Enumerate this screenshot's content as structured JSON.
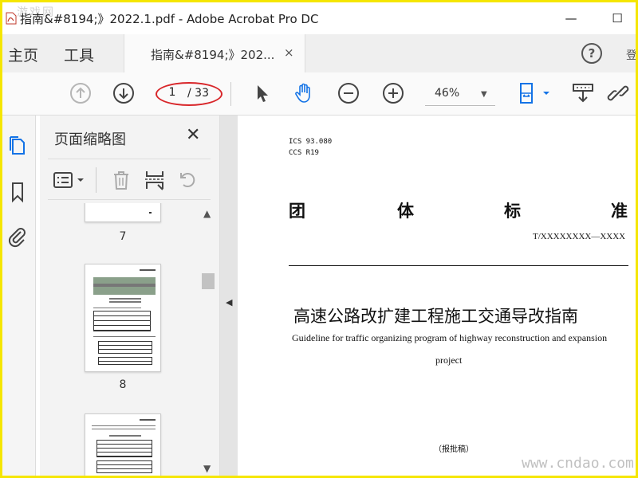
{
  "window": {
    "title": "指南&#8194;》2022.1.pdf - Adobe Acrobat Pro DC",
    "minimize": "—",
    "maximize": "☐",
    "watermark_top_left": "游戏网"
  },
  "menu": {
    "home": "主页",
    "tools": "工具"
  },
  "document_tab": {
    "label": "指南&#8194;》202...",
    "close": "×"
  },
  "help": {
    "label": "?"
  },
  "partial_tab": "登",
  "toolbar": {
    "page_current": "1",
    "page_total": "/ 33",
    "zoom": "46%",
    "zoom_caret": "▼"
  },
  "panel": {
    "title": "页面缩略图",
    "close": "✕",
    "thumbnails": [
      {
        "label": "7"
      },
      {
        "label": "8"
      },
      {
        "label": ""
      }
    ],
    "scroll_up": "▲",
    "scroll_down": "▼"
  },
  "splitter_arrow": "◀",
  "page": {
    "ics": "ICS  93.080",
    "ccs": "CCS R19",
    "standard_chars": [
      "团",
      "体",
      "标",
      "准"
    ],
    "code": "T/XXXXXXXX—XXXX",
    "title_cn": "高速公路改扩建工程施工交通导改指南",
    "title_en_line1": "Guideline for traffic organizing program of highway reconstruction and expansion",
    "title_en_line2": "project",
    "draft_note": "（报批稿）"
  },
  "watermark_bottom_right": "www.cndao.com",
  "colors": {
    "frame": "#f5e600",
    "annotation_oval": "#d8262a",
    "tool_active_blue": "#1473e6"
  }
}
